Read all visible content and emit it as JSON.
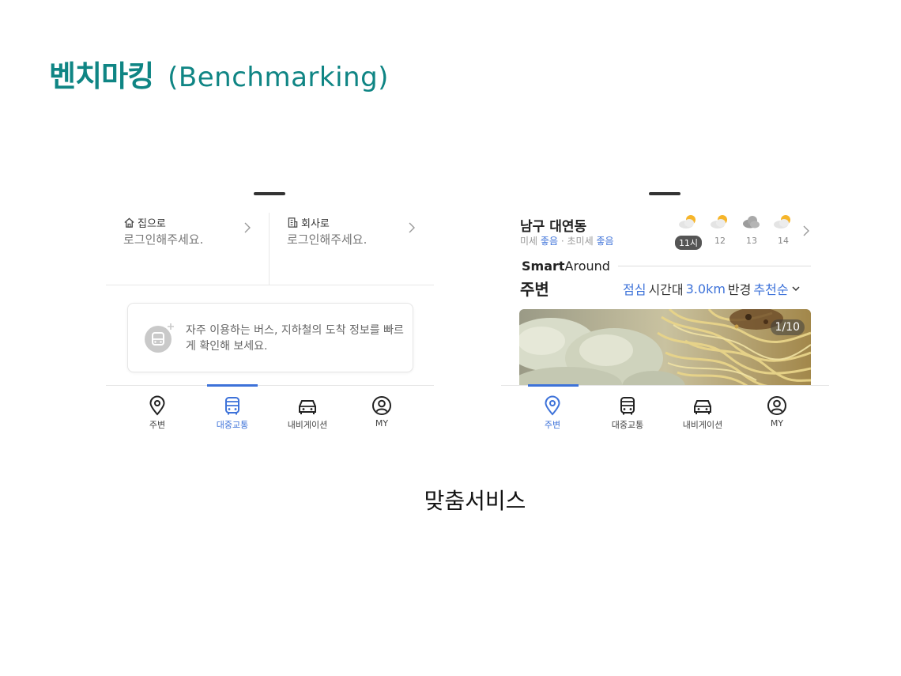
{
  "slide": {
    "title_main": "벤치마킹",
    "title_sub": "(Benchmarking)",
    "caption": "맞춤서비스"
  },
  "colors": {
    "title": "#0f8584",
    "accent_blue": "#3d72d9",
    "active_time_badge": "#555555"
  },
  "left_screen": {
    "home": {
      "icon": "home-icon",
      "label": "집으로",
      "sub": "로그인해주세요."
    },
    "office": {
      "icon": "building-icon",
      "label": "회사로",
      "sub": "로그인해주세요."
    },
    "transit_prompt": "자주 이용하는 버스, 지하철의 도착 정보를 빠르게 확인해 보세요.",
    "active_tab": "대중교통"
  },
  "right_screen": {
    "location": "남구 대연동",
    "air_quality": {
      "fine_label": "미세",
      "fine_value": "좋음",
      "separator": "·",
      "ultra_label": "초미세",
      "ultra_value": "좋음"
    },
    "weather": [
      {
        "time": "11시",
        "icon": "partly-sunny-icon",
        "active": true
      },
      {
        "time": "12",
        "icon": "partly-sunny-icon",
        "active": false
      },
      {
        "time": "13",
        "icon": "cloud-icon",
        "active": false
      },
      {
        "time": "14",
        "icon": "partly-sunny-icon",
        "active": false
      }
    ],
    "brand_bold": "Smart",
    "brand_light": "Around",
    "section_title": "주변",
    "filters": {
      "time": "점심",
      "time_suffix": "시간대",
      "radius": "3.0km",
      "radius_suffix": "반경",
      "sort": "추천순"
    },
    "photo_counter": "1/10",
    "active_tab": "주변"
  },
  "tabs": [
    {
      "label": "주변",
      "icon": "location-pin-icon"
    },
    {
      "label": "대중교통",
      "icon": "bus-icon"
    },
    {
      "label": "내비게이션",
      "icon": "car-icon"
    },
    {
      "label": "MY",
      "icon": "user-circle-icon"
    }
  ]
}
